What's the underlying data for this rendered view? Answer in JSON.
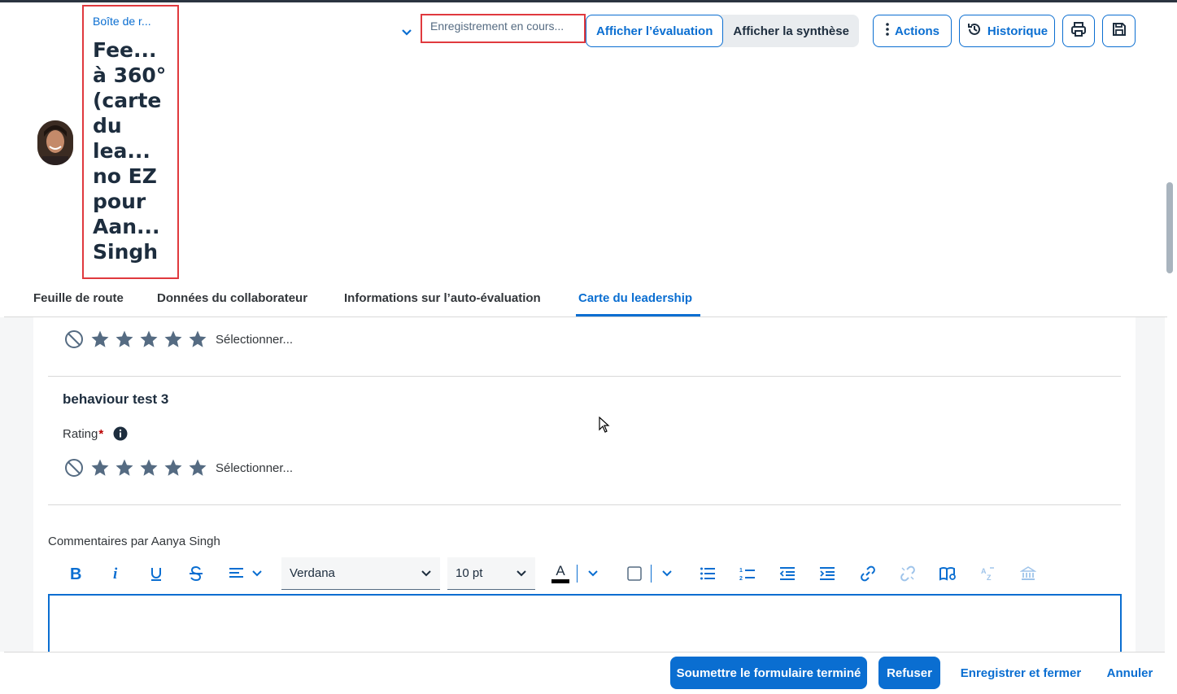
{
  "header": {
    "breadcrumb": "Boîte de r...",
    "title_lines": [
      "Fee...",
      "à 360°",
      "(carte",
      "du",
      "lea...",
      "no EZ",
      "pour",
      "Aan...",
      "Singh"
    ],
    "saving_status": "Enregistrement en cours...",
    "view_toggle": {
      "evaluation": "Afficher l’évaluation",
      "summary": "Afficher la synthèse"
    },
    "actions_label": "Actions",
    "history_label": "Historique"
  },
  "tabs": [
    {
      "label": "Feuille de route",
      "active": false
    },
    {
      "label": "Données du collaborateur",
      "active": false
    },
    {
      "label": "Informations sur l’auto-évaluation",
      "active": false
    },
    {
      "label": "Carte du leadership",
      "active": true
    }
  ],
  "section_prev": {
    "select_label": "Sélectionner..."
  },
  "behaviour": {
    "title": "behaviour test 3",
    "rating_label": "Rating",
    "required_mark": "*",
    "select_label": "Sélectionner..."
  },
  "comments": {
    "label": "Commentaires par Aanya Singh",
    "font_family": "Verdana",
    "font_size": "10 pt",
    "text_color_glyph": "A"
  },
  "footer": {
    "submit": "Soumettre le formulaire terminé",
    "refuse": "Refuser",
    "save_close": "Enregistrer et fermer",
    "cancel": "Annuler"
  },
  "colors": {
    "accent": "#0a6ed1",
    "star": "#556b82",
    "highlight": "#e0393e"
  }
}
